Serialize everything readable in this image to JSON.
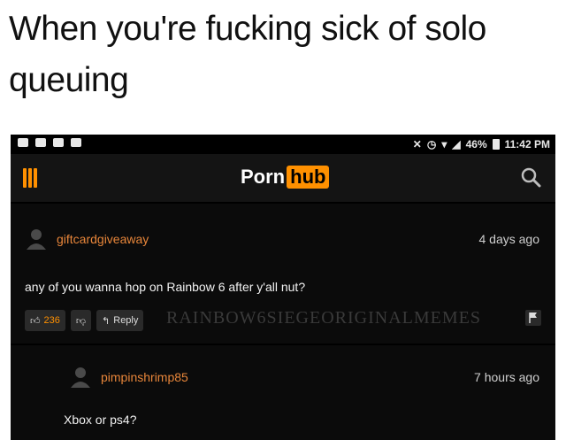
{
  "caption": "When you're fucking sick of solo queuing",
  "statusbar": {
    "battery": "46%",
    "time": "11:42 PM"
  },
  "header": {
    "logo_left": "Porn",
    "logo_right": "hub"
  },
  "comments": [
    {
      "username": "giftcardgiveaway",
      "time": "4 days ago",
      "text": "any of you wanna hop on Rainbow 6 after y'all nut?",
      "likes": "236",
      "reply_label": "Reply"
    },
    {
      "username": "pimpinshrimp85",
      "time": "7 hours ago",
      "text": "Xbox or ps4?"
    }
  ],
  "watermark": "RAINBOW6SIEGEORIGINALMEMES",
  "colors": {
    "accent": "#ff9000",
    "background": "#000000",
    "username": "#e8863a"
  }
}
